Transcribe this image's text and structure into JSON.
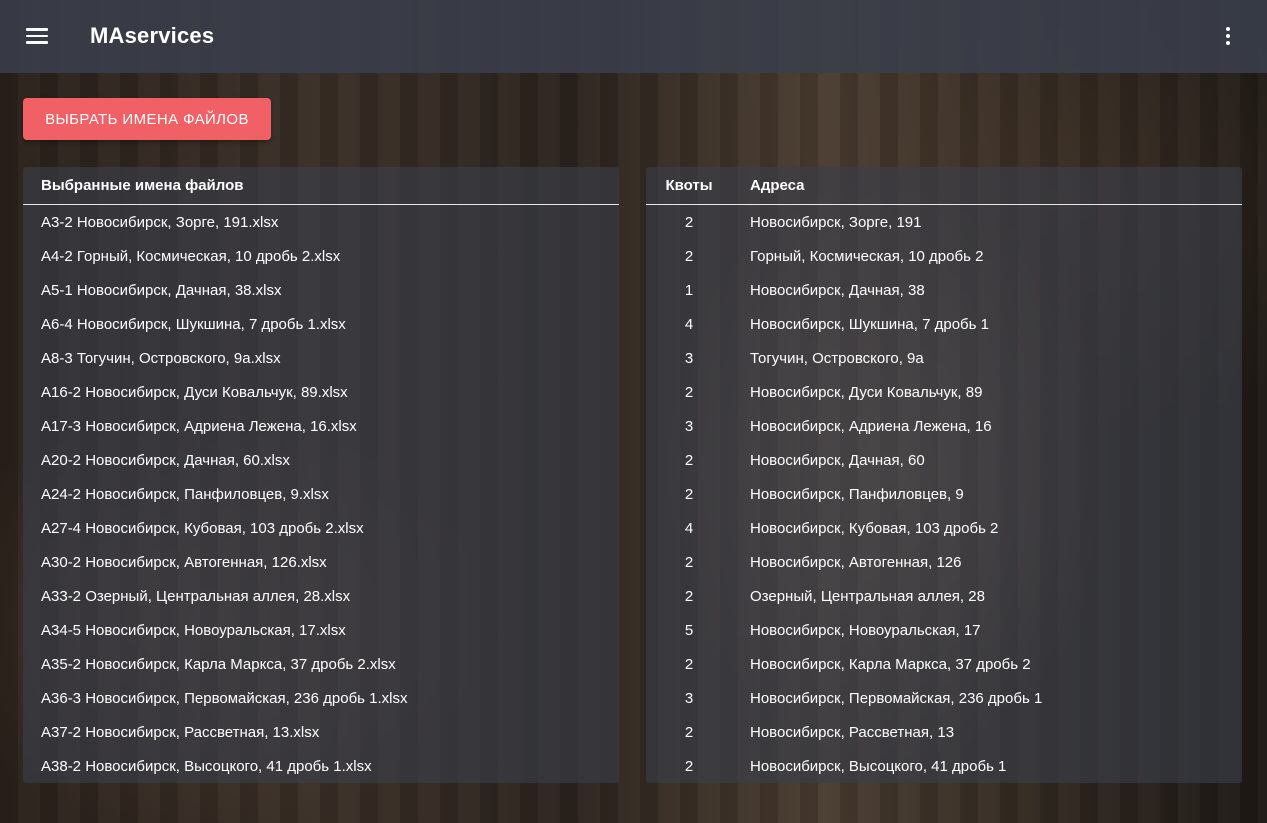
{
  "appbar": {
    "title": "MAservices",
    "menu_icon": "menu-icon",
    "more_icon": "more-vert-icon"
  },
  "actions": {
    "select_files_label": "ВЫБРАТЬ ИМЕНА ФАЙЛОВ"
  },
  "colors": {
    "accent": "#f06064",
    "appbar": "#3a3f4b"
  },
  "files_table": {
    "header": "Выбранные имена файлов",
    "rows": [
      "А3-2 Новосибирск, Зорге, 191.xlsx",
      "А4-2 Горный, Космическая, 10 дробь 2.xlsx",
      "А5-1 Новосибирск, Дачная, 38.xlsx",
      "А6-4 Новосибирск, Шукшина, 7 дробь 1.xlsx",
      "А8-3 Тогучин, Островского, 9а.xlsx",
      "А16-2 Новосибирск, Дуси Ковальчук, 89.xlsx",
      "А17-3 Новосибирск, Адриена Лежена, 16.xlsx",
      "А20-2 Новосибирск, Дачная, 60.xlsx",
      "А24-2 Новосибирск, Панфиловцев, 9.xlsx",
      "А27-4 Новосибирск, Кубовая, 103 дробь 2.xlsx",
      "А30-2 Новосибирск, Автогенная, 126.xlsx",
      "А33-2 Озерный, Центральная аллея, 28.xlsx",
      "А34-5 Новосибирск, Новоуральская, 17.xlsx",
      "А35-2 Новосибирск, Карла Маркса, 37 дробь 2.xlsx",
      "А36-3 Новосибирск, Первомайская, 236 дробь 1.xlsx",
      "А37-2 Новосибирск, Рассветная, 13.xlsx",
      "А38-2 Новосибирск, Высоцкого, 41 дробь 1.xlsx"
    ]
  },
  "quota_table": {
    "headers": {
      "quota": "Квоты",
      "address": "Адреса"
    },
    "rows": [
      {
        "quota": "2",
        "address": "Новосибирск, Зорге, 191"
      },
      {
        "quota": "2",
        "address": "Горный, Космическая, 10 дробь 2"
      },
      {
        "quota": "1",
        "address": "Новосибирск, Дачная, 38"
      },
      {
        "quota": "4",
        "address": "Новосибирск, Шукшина, 7 дробь 1"
      },
      {
        "quota": "3",
        "address": "Тогучин, Островского, 9а"
      },
      {
        "quota": "2",
        "address": "Новосибирск, Дуси Ковальчук, 89"
      },
      {
        "quota": "3",
        "address": "Новосибирск, Адриена Лежена, 16"
      },
      {
        "quota": "2",
        "address": "Новосибирск, Дачная, 60"
      },
      {
        "quota": "2",
        "address": "Новосибирск, Панфиловцев, 9"
      },
      {
        "quota": "4",
        "address": "Новосибирск, Кубовая, 103 дробь 2"
      },
      {
        "quota": "2",
        "address": "Новосибирск, Автогенная, 126"
      },
      {
        "quota": "2",
        "address": "Озерный, Центральная аллея, 28"
      },
      {
        "quota": "5",
        "address": "Новосибирск, Новоуральская, 17"
      },
      {
        "quota": "2",
        "address": "Новосибирск, Карла Маркса, 37 дробь 2"
      },
      {
        "quota": "3",
        "address": "Новосибирск, Первомайская, 236 дробь 1"
      },
      {
        "quota": "2",
        "address": "Новосибирск, Рассветная, 13"
      },
      {
        "quota": "2",
        "address": "Новосибирск, Высоцкого, 41 дробь 1"
      }
    ]
  }
}
